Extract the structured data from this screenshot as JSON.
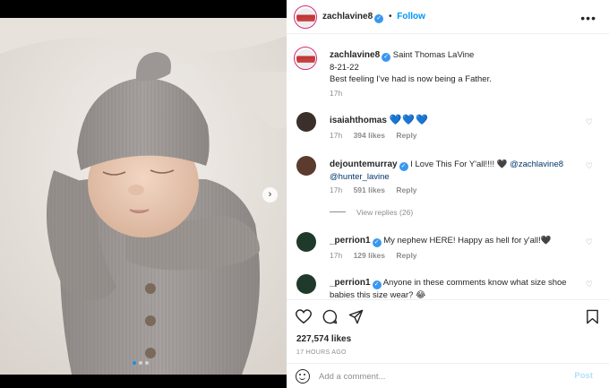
{
  "post": {
    "author": "zachlavine8",
    "follow_label": "Follow",
    "separator": "•",
    "more_glyph": "•••",
    "caption": {
      "tagged": "Saint Thomas LaVine",
      "date": "8-21-22",
      "text": "Best feeling I've had is now being a Father.",
      "time": "17h"
    },
    "next_glyph": "›",
    "carousel_active": 1,
    "carousel_count": 3
  },
  "comments": [
    {
      "user": "isaiahthomas",
      "text_prefix": "",
      "text": "",
      "hearts": "💙💙💙",
      "time": "17h",
      "likes": "394 likes",
      "reply": "Reply",
      "avatar_color": "#3a2f2a"
    },
    {
      "user": "dejountemurray",
      "text": "I Love This For Y'all!!!! 🖤",
      "mention1": "@zachlavine8",
      "mention2": "@hunter_lavine",
      "time": "17h",
      "likes": "591 likes",
      "reply": "Reply",
      "avatar_color": "#5a3b2e"
    },
    {
      "user": "_perrion1",
      "text": "My nephew HERE! Happy as hell for y'all!🖤",
      "time": "17h",
      "likes": "129 likes",
      "reply": "Reply",
      "avatar_color": "#1f3a2a"
    },
    {
      "user": "_perrion1",
      "text": "Anyone in these comments know what size shoe babies this size wear? 😂",
      "avatar_color": "#1f3a2a"
    }
  ],
  "view_replies": "View replies (26)",
  "likes_count": "227,574 likes",
  "time_ago": "17 HOURS AGO",
  "comment_input": {
    "placeholder": "Add a comment...",
    "post_label": "Post"
  },
  "icons": {
    "heart": "heart-icon",
    "comment": "comment-icon",
    "share": "share-icon",
    "save": "bookmark-icon",
    "emoji": "emoji-icon",
    "more": "more-icon"
  },
  "colors": {
    "link": "#0095f6",
    "verified": "#3897f0",
    "muted": "#8e8e8e",
    "text": "#262626"
  }
}
